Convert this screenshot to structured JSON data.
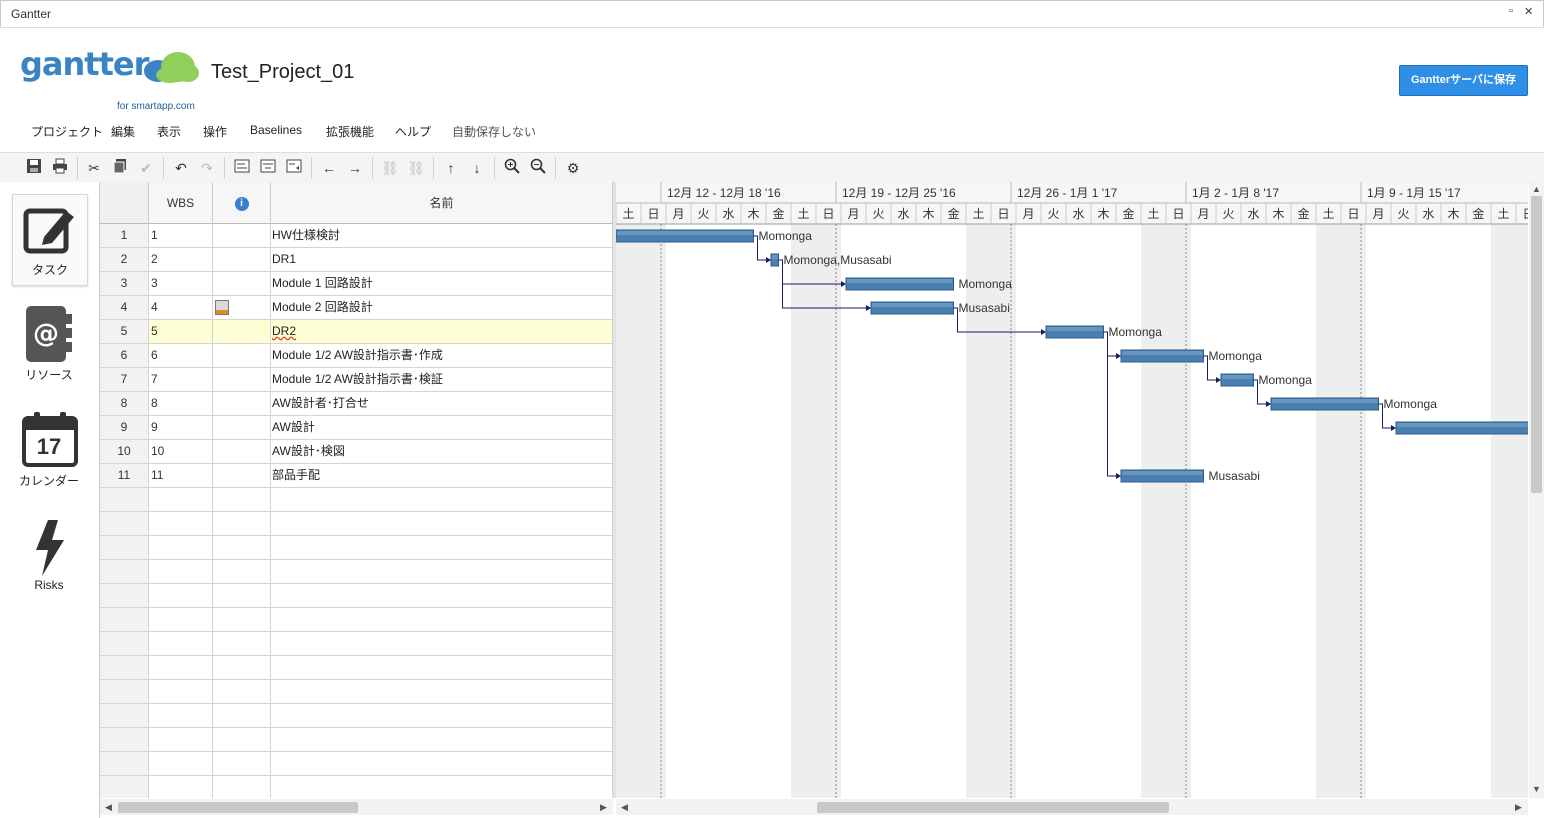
{
  "window": {
    "title": "Gantter"
  },
  "header": {
    "logo_text": "gantter",
    "logo_sub": "for smartapp.com",
    "project_title": "Test_Project_01",
    "save_label": "Gantterサーバに保存"
  },
  "menu": [
    "プロジェクト",
    "編集",
    "表示",
    "操作",
    "Baselines",
    "拡張機能",
    "ヘルプ",
    "自動保存しない"
  ],
  "toolbar_icons": [
    "save-icon",
    "print-icon",
    "cut-icon",
    "copy-icon",
    "paste-icon",
    "undo-icon",
    "redo-icon",
    "insert-task-icon",
    "insert-summary-icon",
    "insert-milestone-icon",
    "outdent-icon",
    "indent-icon",
    "link-icon",
    "unlink-icon",
    "move-up-icon",
    "move-down-icon",
    "zoom-in-icon",
    "zoom-out-icon",
    "settings-icon"
  ],
  "nav": [
    {
      "label": "タスク",
      "icon": "task-edit-icon"
    },
    {
      "label": "リソース",
      "icon": "resource-contact-icon"
    },
    {
      "label": "カレンダー",
      "icon": "calendar-icon",
      "day": "17"
    },
    {
      "label": "Risks",
      "icon": "lightning-icon"
    }
  ],
  "grid": {
    "headers": {
      "wbs": "WBS",
      "info": "i",
      "name": "名前"
    },
    "rows": [
      {
        "id": "1",
        "wbs": "1",
        "name": "HW仕様検討"
      },
      {
        "id": "2",
        "wbs": "2",
        "name": "DR1"
      },
      {
        "id": "3",
        "wbs": "3",
        "name": "Module 1 回路設計"
      },
      {
        "id": "4",
        "wbs": "4",
        "name": "Module 2 回路設計",
        "note": true
      },
      {
        "id": "5",
        "wbs": "5",
        "name": "DR2",
        "selected": true
      },
      {
        "id": "6",
        "wbs": "6",
        "name": "Module 1/2 AW設計指示書･作成"
      },
      {
        "id": "7",
        "wbs": "7",
        "name": "Module 1/2 AW設計指示書･検証"
      },
      {
        "id": "8",
        "wbs": "8",
        "name": "AW設計者･打合せ"
      },
      {
        "id": "9",
        "wbs": "9",
        "name": "AW設計"
      },
      {
        "id": "10",
        "wbs": "10",
        "name": "AW設計･検図"
      },
      {
        "id": "11",
        "wbs": "11",
        "name": "部品手配"
      }
    ],
    "empty_rows": 13
  },
  "gantt": {
    "weeks": [
      "12月 12 - 12月 18 '16",
      "12月 19 - 12月 25 '16",
      "12月 26 - 1月 1 '17",
      "1月 2 - 1月 8 '17",
      "1月 9 - 1月 15 '17"
    ],
    "days": [
      "土",
      "日",
      "月",
      "火",
      "水",
      "木",
      "金",
      "土",
      "日",
      "月",
      "火",
      "水",
      "木",
      "金",
      "土",
      "日",
      "月",
      "火",
      "水",
      "木",
      "金",
      "土",
      "日",
      "月",
      "火",
      "水",
      "木",
      "金",
      "土",
      "日",
      "月",
      "火",
      "水",
      "木",
      "金",
      "土",
      "日"
    ],
    "bars": [
      {
        "row": 0,
        "start": 0,
        "dur": 5.5,
        "label": "Momonga"
      },
      {
        "row": 1,
        "start": 6.2,
        "dur": 0.3,
        "label": "Momonga,Musasabi"
      },
      {
        "row": 2,
        "start": 9.2,
        "dur": 4.3,
        "label": "Momonga"
      },
      {
        "row": 3,
        "start": 10.2,
        "dur": 3.3,
        "label": "Musasabi"
      },
      {
        "row": 4,
        "start": 17.2,
        "dur": 2.3,
        "label": "Momonga"
      },
      {
        "row": 5,
        "start": 20.2,
        "dur": 3.3,
        "label": "Momonga"
      },
      {
        "row": 6,
        "start": 24.2,
        "dur": 1.3,
        "label": "Momonga"
      },
      {
        "row": 7,
        "start": 26.2,
        "dur": 4.3,
        "label": "Momonga"
      },
      {
        "row": 8,
        "start": 31.2,
        "dur": 5.3,
        "label": ""
      },
      {
        "row": 10,
        "start": 20.2,
        "dur": 3.3,
        "label": "Musasabi"
      }
    ],
    "links": [
      [
        0,
        1
      ],
      [
        1,
        2
      ],
      [
        1,
        3
      ],
      [
        3,
        4
      ],
      [
        4,
        5
      ],
      [
        4,
        10
      ],
      [
        5,
        6
      ],
      [
        6,
        7
      ],
      [
        7,
        8
      ]
    ]
  },
  "colors": {
    "accent": "#2f8fe6",
    "bar": "#4a7fb0",
    "bar_dark": "#2c5c8c",
    "weekend": "#eeeeee",
    "selected_row": "#ffffd6",
    "link": "#1a1a66"
  }
}
